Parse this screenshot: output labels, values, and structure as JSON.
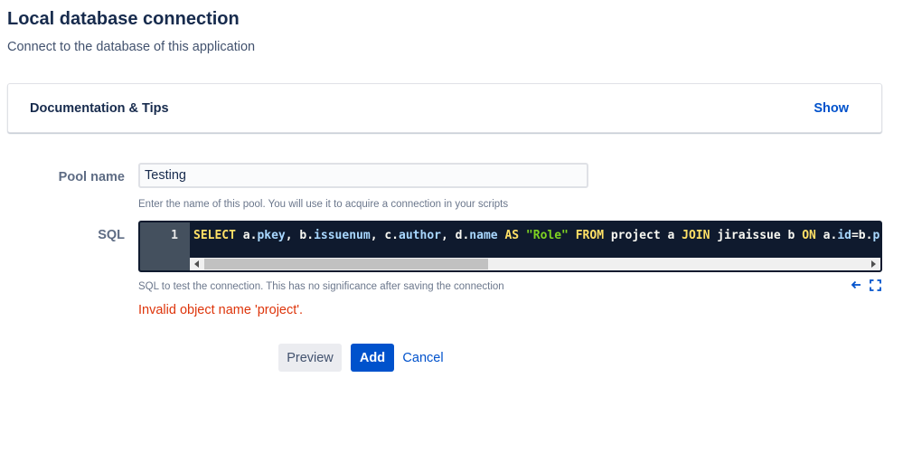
{
  "page": {
    "title": "Local database connection",
    "subtitle": "Connect to the database of this application"
  },
  "doc_panel": {
    "title": "Documentation & Tips",
    "toggle_label": "Show"
  },
  "pool_name": {
    "label": "Pool name",
    "value": "Testing",
    "help": "Enter the name of this pool. You will use it to acquire a connection in your scripts"
  },
  "sql": {
    "label": "SQL",
    "line_number": "1",
    "tokens": [
      {
        "text": "SELECT",
        "color": "#ffe066"
      },
      {
        "text": " a.",
        "color": "#f8f8f2"
      },
      {
        "text": "pkey",
        "color": "#a9d8ff"
      },
      {
        "text": ", b.",
        "color": "#f8f8f2"
      },
      {
        "text": "issuenum",
        "color": "#a9d8ff"
      },
      {
        "text": ", c.",
        "color": "#f8f8f2"
      },
      {
        "text": "author",
        "color": "#a9d8ff"
      },
      {
        "text": ", d.",
        "color": "#f8f8f2"
      },
      {
        "text": "name",
        "color": "#a9d8ff"
      },
      {
        "text": " ",
        "color": "#f8f8f2"
      },
      {
        "text": "AS",
        "color": "#ffe066"
      },
      {
        "text": " ",
        "color": "#f8f8f2"
      },
      {
        "text": "\"Role\"",
        "color": "#7ed321"
      },
      {
        "text": " ",
        "color": "#f8f8f2"
      },
      {
        "text": "FROM",
        "color": "#ffe066"
      },
      {
        "text": " project a ",
        "color": "#f8f8f2"
      },
      {
        "text": "JOIN",
        "color": "#ffe066"
      },
      {
        "text": " jiraissue b ",
        "color": "#f8f8f2"
      },
      {
        "text": "ON",
        "color": "#ffe066"
      },
      {
        "text": " a.",
        "color": "#f8f8f2"
      },
      {
        "text": "id",
        "color": "#a9d8ff"
      },
      {
        "text": "=b.",
        "color": "#f8f8f2"
      },
      {
        "text": "project",
        "color": "#a9d8ff"
      }
    ],
    "help": "SQL to test the connection. This has no significance after saving the connection"
  },
  "error": "Invalid object name 'project'.",
  "buttons": {
    "preview": "Preview",
    "add": "Add",
    "cancel": "Cancel"
  },
  "colors": {
    "primary": "#0052cc",
    "error": "#de350b",
    "editor_bg": "#0f1a2e"
  }
}
